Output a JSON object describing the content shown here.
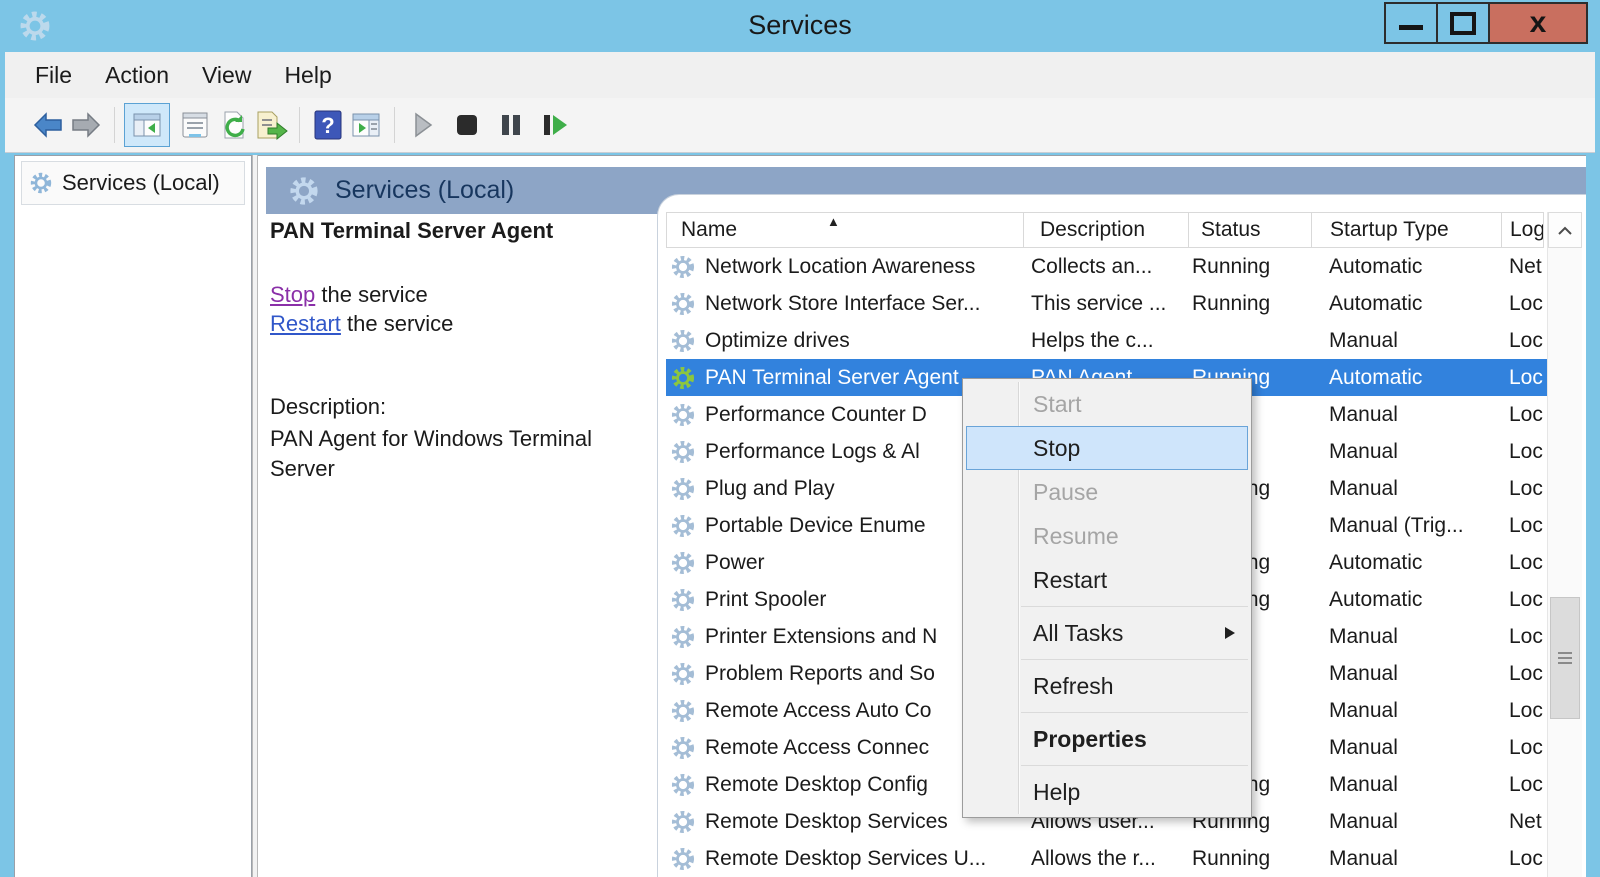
{
  "window": {
    "title": "Services",
    "close_glyph": "x"
  },
  "menu_bar": {
    "items": [
      "File",
      "Action",
      "View",
      "Help"
    ]
  },
  "toolbar": {
    "buttons": [
      "back",
      "forward",
      "show-console-tree",
      "properties",
      "refresh",
      "export-list",
      "help",
      "show-action-pane",
      "start-service",
      "stop-service",
      "pause-service",
      "restart-service"
    ]
  },
  "tree": {
    "root_label": "Services (Local)"
  },
  "extended_pane": {
    "header": "Services (Local)",
    "selected_service": "PAN Terminal Server Agent",
    "stop_link": "Stop",
    "stop_suffix": " the service",
    "restart_link": "Restart",
    "restart_suffix": " the service",
    "description_label": "Description:",
    "description": "PAN Agent for Windows Terminal Server"
  },
  "table": {
    "columns": [
      "Name",
      "Description",
      "Status",
      "Startup Type",
      "Log"
    ],
    "sort_column": "Name",
    "sort_marker": "▲",
    "rows": [
      {
        "name": "Network Location Awareness",
        "description": "Collects an...",
        "status": "Running",
        "startup_type": "Automatic",
        "log_on_as": "Net",
        "selected": false
      },
      {
        "name": "Network Store Interface Ser...",
        "description": "This service ...",
        "status": "Running",
        "startup_type": "Automatic",
        "log_on_as": "Loc",
        "selected": false
      },
      {
        "name": "Optimize drives",
        "description": "Helps the c...",
        "status": "",
        "startup_type": "Manual",
        "log_on_as": "Loc",
        "selected": false
      },
      {
        "name": "PAN Terminal Server Agent",
        "description": "PAN Agent...",
        "status": "Running",
        "startup_type": "Automatic",
        "log_on_as": "Loc",
        "selected": true
      },
      {
        "name": "Performance Counter D",
        "description": "",
        "status": "",
        "startup_type": "Manual",
        "log_on_as": "Loc",
        "selected": false
      },
      {
        "name": "Performance Logs & Al",
        "description": "",
        "status": "",
        "startup_type": "Manual",
        "log_on_as": "Loc",
        "selected": false
      },
      {
        "name": "Plug and Play",
        "description": "",
        "status": "Running",
        "startup_type": "Manual",
        "log_on_as": "Loc",
        "selected": false
      },
      {
        "name": "Portable Device Enume",
        "description": "",
        "status": "",
        "startup_type": "Manual (Trig...",
        "log_on_as": "Loc",
        "selected": false
      },
      {
        "name": "Power",
        "description": "",
        "status": "Running",
        "startup_type": "Automatic",
        "log_on_as": "Loc",
        "selected": false
      },
      {
        "name": "Print Spooler",
        "description": "",
        "status": "Running",
        "startup_type": "Automatic",
        "log_on_as": "Loc",
        "selected": false
      },
      {
        "name": "Printer Extensions and N",
        "description": "",
        "status": "",
        "startup_type": "Manual",
        "log_on_as": "Loc",
        "selected": false
      },
      {
        "name": "Problem Reports and So",
        "description": "",
        "status": "",
        "startup_type": "Manual",
        "log_on_as": "Loc",
        "selected": false
      },
      {
        "name": "Remote Access Auto Co",
        "description": "",
        "status": "",
        "startup_type": "Manual",
        "log_on_as": "Loc",
        "selected": false
      },
      {
        "name": "Remote Access Connec",
        "description": "",
        "status": "",
        "startup_type": "Manual",
        "log_on_as": "Loc",
        "selected": false
      },
      {
        "name": "Remote Desktop Config",
        "description": "",
        "status": "Running",
        "startup_type": "Manual",
        "log_on_as": "Loc",
        "selected": false
      },
      {
        "name": "Remote Desktop Services",
        "description": "Allows user...",
        "status": "Running",
        "startup_type": "Manual",
        "log_on_as": "Net",
        "selected": false
      },
      {
        "name": "Remote Desktop Services U...",
        "description": "Allows the r...",
        "status": "Running",
        "startup_type": "Manual",
        "log_on_as": "Loc",
        "selected": false
      }
    ]
  },
  "context_menu": {
    "items": [
      {
        "label": "Start",
        "state": "disabled"
      },
      {
        "label": "Stop",
        "state": "highlighted"
      },
      {
        "label": "Pause",
        "state": "disabled"
      },
      {
        "label": "Resume",
        "state": "disabled"
      },
      {
        "label": "Restart",
        "state": "normal"
      },
      {
        "separator": true
      },
      {
        "label": "All Tasks",
        "state": "normal",
        "submenu": true
      },
      {
        "separator": true
      },
      {
        "label": "Refresh",
        "state": "normal"
      },
      {
        "separator": true
      },
      {
        "label": "Properties",
        "state": "default-bold"
      },
      {
        "separator": true
      },
      {
        "label": "Help",
        "state": "normal"
      }
    ]
  },
  "colors": {
    "titlebar": "#7cc5e6",
    "close_button": "#c96f5f",
    "selection_blue": "#3282dd",
    "band_blue": "#8da5c6",
    "stop_link": "#8a2fa8",
    "restart_link": "#3157c9",
    "menu_highlight_bg": "#cfe5fb",
    "menu_highlight_border": "#6aa4d8"
  }
}
